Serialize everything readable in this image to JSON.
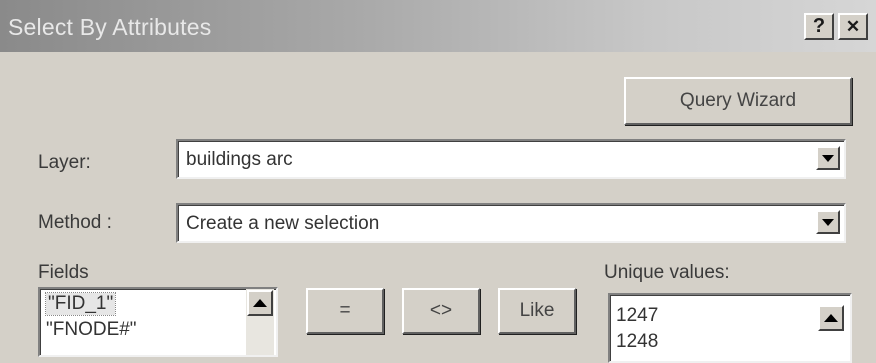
{
  "window": {
    "title": "Select By Attributes",
    "help_label": "?",
    "close_label": "✕"
  },
  "query_wizard_label": "Query Wizard",
  "layer": {
    "label": "Layer:",
    "value": "buildings arc"
  },
  "method": {
    "label": "Method :",
    "value": "Create a new selection"
  },
  "fields": {
    "label": "Fields",
    "items": [
      "\"FID_1\"",
      "\"FNODE#\""
    ]
  },
  "operators": {
    "equals": "=",
    "not_equal": "<>",
    "like": "Like"
  },
  "unique_values": {
    "label": "Unique values:",
    "items": [
      "1247",
      "1248"
    ]
  },
  "icons": {
    "help": "help-icon",
    "close": "close-icon",
    "dropdown": "chevron-down-icon",
    "scroll_up": "scroll-up-arrow-icon"
  }
}
